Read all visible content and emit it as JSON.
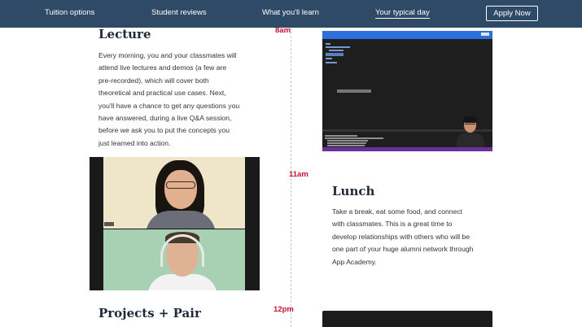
{
  "nav": {
    "items": [
      {
        "label": "Tuition options",
        "active": false
      },
      {
        "label": "Student reviews",
        "active": false
      },
      {
        "label": "What you'll learn",
        "active": false
      },
      {
        "label": "Your typical day",
        "active": true
      }
    ],
    "cta_label": "Apply Now"
  },
  "sections": [
    {
      "time": "8am",
      "title": "Lecture",
      "lines": [
        "Every morning, you and your classmates will",
        "attend live lectures and demos (a few are",
        "pre-recorded), which will cover both",
        "theoretical and practical use cases. Next,",
        "you'll have a chance to get any questions you",
        "have answered, during a live Q&A session,",
        "before we ask you to put the concepts you",
        "just learned into action."
      ]
    },
    {
      "time": "11am",
      "title": "Lunch",
      "lines": [
        "Take a break, eat some food, and connect",
        "with classmates. This is a great time to",
        "develop relationships with others who will be",
        "one part of your huge alumni network through",
        "App Academy."
      ]
    },
    {
      "time": "12pm",
      "title": "Projects + Pair"
    }
  ],
  "colors": {
    "nav_bg": "#2f4a66",
    "time_accent": "#c8102e",
    "heading": "#1f2a37"
  }
}
